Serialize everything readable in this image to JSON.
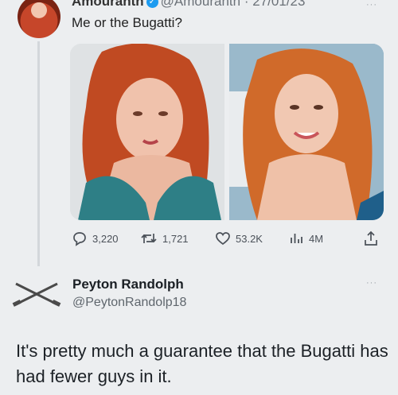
{
  "tweet": {
    "author_name": "Amouranth",
    "handle": "@Amouranth",
    "separator": "·",
    "date": "27/01/23",
    "more_label": "···",
    "text": "Me or the Bugatti?",
    "stats": {
      "replies": "3,220",
      "retweets": "1,721",
      "likes": "53.2K",
      "views": "4M"
    }
  },
  "reply": {
    "author_name": "Peyton Randolph",
    "handle": "@PeytonRandolp18",
    "more_label": "···",
    "text": "It's pretty much a guarantee that the Bugatti has had fewer guys in it."
  },
  "icons": {
    "verified": "verified-badge-icon",
    "reply": "reply-bubble-icon",
    "retweet": "retweet-icon",
    "like": "heart-icon",
    "views": "views-bar-chart-icon",
    "share": "share-upload-icon"
  },
  "colors": {
    "background": "#eceef0",
    "verified": "#1d9bf0",
    "text": "#0f1419",
    "muted": "#5f666d"
  }
}
